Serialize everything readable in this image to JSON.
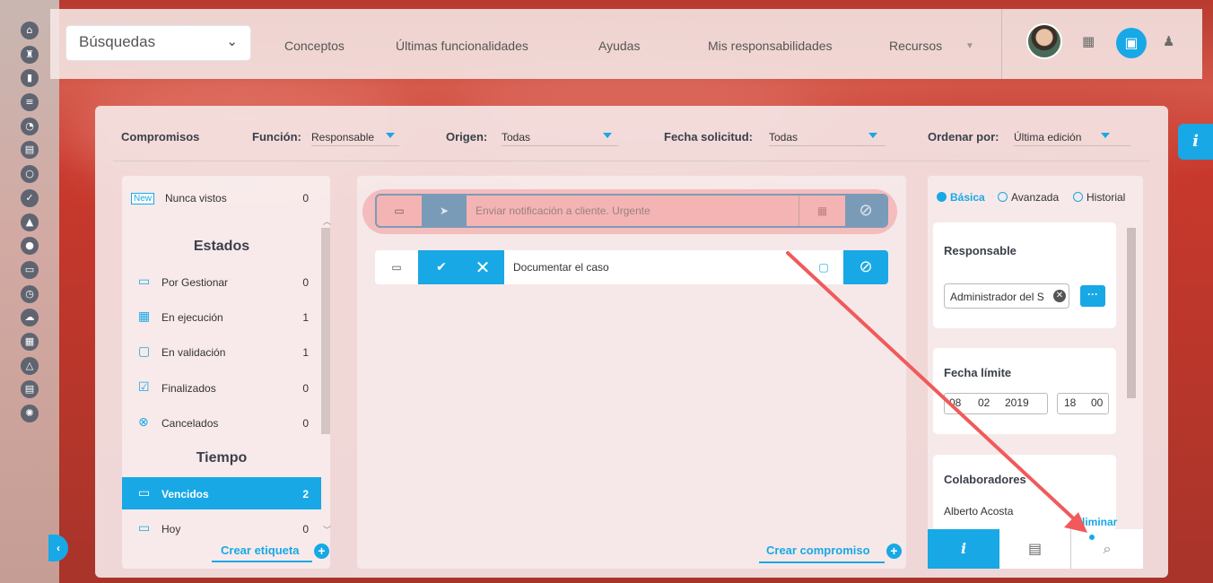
{
  "sidebar": {
    "icons": [
      "home-icon",
      "tower-icon",
      "bar-chart-icon",
      "list-icon",
      "pie-chart-icon",
      "document-icon",
      "cycle-icon",
      "check-circle-icon",
      "warning-icon",
      "toggle-icon",
      "presentation-icon",
      "clock-icon",
      "cloud-icon",
      "calendar-icon",
      "network-icon",
      "file-icon",
      "settings-icon"
    ],
    "toggle_symbol": "‹"
  },
  "topbar": {
    "search_select": "Búsquedas",
    "nav": [
      "Conceptos",
      "Últimas funcionalidades",
      "Ayudas",
      "Mis responsabilidades",
      "Recursos"
    ],
    "icons": [
      "avatar",
      "calendar-icon",
      "document-icon",
      "bell-icon"
    ]
  },
  "filters": {
    "title": "Compromisos",
    "funcion_label": "Función:",
    "funcion_value": "Responsable",
    "origen_label": "Origen:",
    "origen_value": "Todas",
    "fecha_label": "Fecha solicitud:",
    "fecha_value": "Todas",
    "ordenar_label": "Ordenar por:",
    "ordenar_value": "Última edición"
  },
  "left_list": {
    "new_badge": "New",
    "nunca_vistos": {
      "label": "Nunca vistos",
      "count": "0"
    },
    "estados_title": "Estados",
    "estados": [
      {
        "label": "Por Gestionar",
        "count": "0",
        "icon": "calendar-icon"
      },
      {
        "label": "En ejecución",
        "count": "1",
        "icon": "calendar-grid-icon"
      },
      {
        "label": "En validación",
        "count": "1",
        "icon": "search-document-icon"
      },
      {
        "label": "Finalizados",
        "count": "0",
        "icon": "checkbox-icon"
      },
      {
        "label": "Cancelados",
        "count": "0",
        "icon": "cancel-circle-icon"
      }
    ],
    "tiempo_title": "Tiempo",
    "tiempo": [
      {
        "label": "Vencidos",
        "count": "2",
        "icon": "calendar-overdue-icon"
      },
      {
        "label": "Hoy",
        "count": "0",
        "icon": "calendar-today-icon"
      }
    ],
    "create_label": "Crear etiqueta"
  },
  "center": {
    "items": [
      {
        "text": "Enviar notificación a cliente. Urgente",
        "highlighted": true
      },
      {
        "text": "Documentar el caso",
        "highlighted": false
      }
    ],
    "create_label": "Crear compromiso"
  },
  "right_panel": {
    "modes": [
      "Básica",
      "Avanzada",
      "Historial"
    ],
    "selected_mode": "Básica",
    "responsable_title": "Responsable",
    "responsable_value": "Administrador del S",
    "fecha_limite_title": "Fecha límite",
    "fecha": {
      "day": "08",
      "month": "02",
      "year": "2019",
      "hour": "18",
      "minute": "00"
    },
    "colaboradores_title": "Colaboradores",
    "colaborador": "Alberto Acosta",
    "eliminar": "Eliminar",
    "tabs": [
      "info-icon",
      "comment-icon",
      "attachment-icon"
    ]
  },
  "colors": {
    "accent": "#18a8e6",
    "annotation": "#f05a5a"
  }
}
